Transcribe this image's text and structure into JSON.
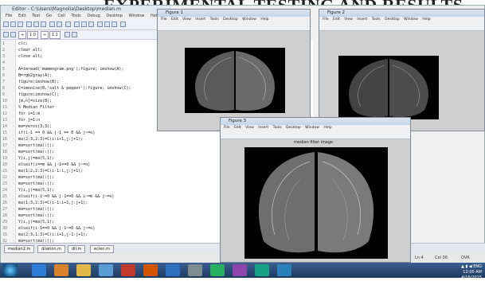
{
  "banner": {
    "text": "EXPERIMENTAL TESTING AND RESULTS"
  },
  "editor": {
    "title": "Editor - C:\\Users\\Magnolia\\Desktop\\median.m",
    "menu": [
      "File",
      "Edit",
      "Text",
      "Go",
      "Cell",
      "Tools",
      "Debug",
      "Desktop",
      "Window",
      "Help"
    ],
    "toolbar2": {
      "value1": "1.0",
      "value2": "1.1",
      "op": "+",
      "mul": "÷"
    },
    "line_numbers": [
      "1",
      "2",
      "3",
      "4",
      "5",
      "6",
      "7",
      "8",
      "9",
      "10",
      "11",
      "12",
      "13",
      "14",
      "15",
      "16",
      "17",
      "18",
      "19",
      "20",
      "21",
      "22",
      "23",
      "24",
      "25",
      "26",
      "27",
      "28",
      "29",
      "30",
      "31",
      "32"
    ],
    "code_lines": [
      "clc;",
      "clear all;",
      "close all;",
      "",
      "A=imread('mammogram.png');figure; imshow(A);",
      "B=rgb2gray(A);",
      "figure;imshow(B);",
      "C=imnoise(B,'salt & pepper');figure; imshow(C);",
      "figure;imshow(C);",
      "[m,n]=size(B);",
      "% Median Filter",
      "for i=1:m",
      "  for j=1:n",
      "    ma=zeros(3,3);",
      "    if(i-1 == 0 && j-1 == 0 && j~=n)",
      "      ma(2:3,2:3)=C(i:i+1,j:j+1);",
      "      ma=sort(ma(:));",
      "      ma=sort(ma(:));",
      "      Y(i,j)=ma(5,1);",
      "    elseif(i==m && j-1==0 && j~=n)",
      "      ma(1:2,2:3)=C(i-1:i,j:j+1);",
      "      ma=sort(ma(:));",
      "      ma=sort(ma(:));",
      "      Y(i,j)=ma(5,1);",
      "    elseif(i-1~=0 && j-1==0 && i~=m && j~=n)",
      "      ma(1:3,2:3)=C(i-1:i+1,j:j+1);",
      "      ma=sort(ma(:));",
      "      ma=sort(ma(:));",
      "      Y(i,j)=ma(5,1);",
      "    elseif(i-1==0 && j-1~=0 && j~=n)",
      "      ma(2:3,1:3)=C(i:i+1,j-1:j+1);",
      "      ma=sort(ma(:));"
    ],
    "tabs": [
      "median2.m",
      "dilation.m",
      "dil.m",
      "eclen.m"
    ],
    "status": {
      "ln": "Ln 4",
      "col": "Col 36",
      "ovr": "OVR"
    }
  },
  "figure1": {
    "title": "Figure 1",
    "menu": [
      "File",
      "Edit",
      "View",
      "Insert",
      "Tools",
      "Desktop",
      "Window",
      "Help"
    ]
  },
  "figure2": {
    "title": "Figure 2",
    "menu": [
      "File",
      "Edit",
      "View",
      "Insert",
      "Tools",
      "Desktop",
      "Window",
      "Help"
    ]
  },
  "figure3": {
    "title": "Figure 3",
    "menu": [
      "File",
      "Edit",
      "View",
      "Insert",
      "Tools",
      "Desktop",
      "Window",
      "Help"
    ],
    "plot_title": "median filter image"
  },
  "taskbar": {
    "time": "12:00 AM",
    "date": "4/16/2015",
    "tray_label": "▲ ▮ ◀ ENG"
  },
  "colors": {
    "taskbar": "#1e3a5f",
    "figure_bg": "#cfcfcf",
    "image_bg": "#000000"
  }
}
